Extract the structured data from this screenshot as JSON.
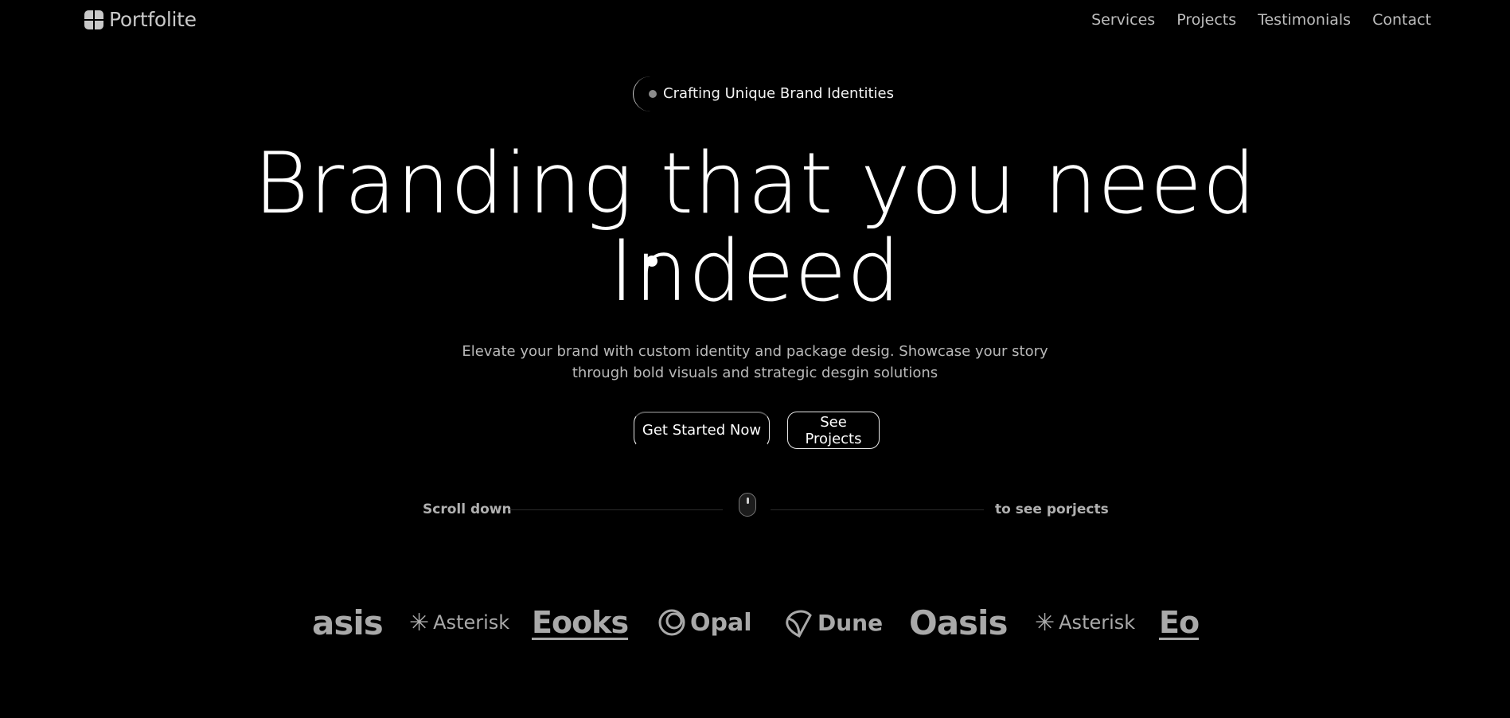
{
  "nav": {
    "logo_text": "Portfolite",
    "links": [
      "Services",
      "Projects",
      "Testimonials",
      "Contact"
    ]
  },
  "hero": {
    "badge": "Crafting Unique Brand Identities",
    "headline_line1": "Branding that you need",
    "headline_line2": "Indeed",
    "subtitle_line1": "Elevate your brand with custom identity and package desig. Showcase your story",
    "subtitle_line2": "through bold visuals and strategic desgin solutions",
    "cta_primary": "Get Started Now",
    "cta_secondary": "See Projects"
  },
  "scroll": {
    "left_text": "Scroll down",
    "right_text": "to see porjects"
  },
  "brands": [
    {
      "name": "asis",
      "icon": ""
    },
    {
      "name": "Asterisk",
      "icon": "asterisk-icon"
    },
    {
      "name": "Eooks",
      "icon": ""
    },
    {
      "name": "Opal",
      "icon": "opal-icon"
    },
    {
      "name": "Dune",
      "icon": "dune-icon"
    },
    {
      "name": "Oasis",
      "icon": ""
    },
    {
      "name": "Asterisk",
      "icon": "asterisk-icon"
    },
    {
      "name": "Eo",
      "icon": ""
    }
  ],
  "colors": {
    "background": "#000000",
    "text_primary": "#ffffff",
    "text_muted": "#b9b9b9",
    "logo_gray": "#a9a9a9"
  }
}
